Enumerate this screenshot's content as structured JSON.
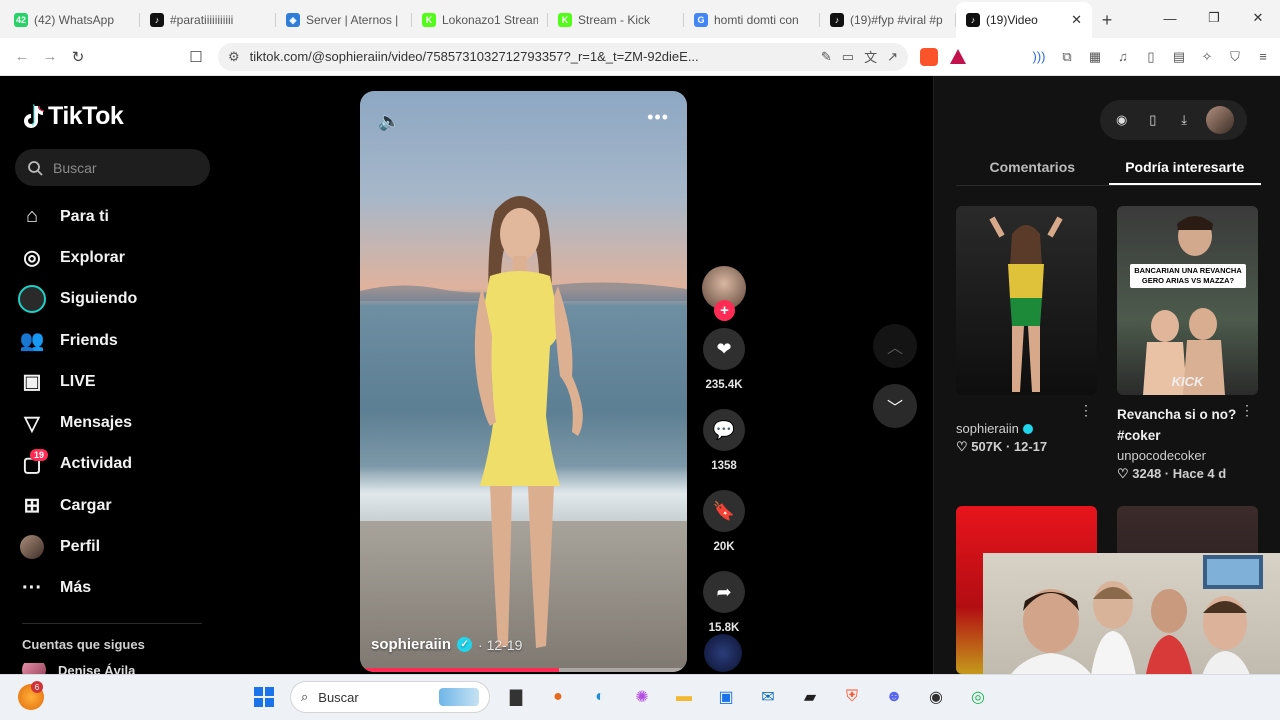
{
  "browser": {
    "tabs": [
      {
        "title": "(42) WhatsApp",
        "fav": "42",
        "color": "#25d366",
        "active": false
      },
      {
        "title": "#paratiiiiiiiiiii",
        "fav": "♪",
        "color": "#111111",
        "active": false
      },
      {
        "title": "Server | Aternos |",
        "fav": "◈",
        "color": "#2f7fd8",
        "active": false
      },
      {
        "title": "Lokonazo1 Stream",
        "fav": "K",
        "color": "#53fc18",
        "active": false
      },
      {
        "title": "Stream - Kick",
        "fav": "K",
        "color": "#53fc18",
        "active": false
      },
      {
        "title": "homti domti con",
        "fav": "G",
        "color": "#4285f4",
        "active": false
      },
      {
        "title": "(19)#fyp #viral #p",
        "fav": "♪",
        "color": "#111111",
        "active": false
      },
      {
        "title": "(19)Video",
        "fav": "♪",
        "color": "#111111",
        "active": true
      }
    ],
    "new_tab": "+",
    "url": "tiktok.com/@sophieraiin/video/7585731032712793357?_r=1&_t=ZM-92dieE..."
  },
  "sidebar": {
    "logo": "TikTok",
    "search_placeholder": "Buscar",
    "items": [
      {
        "label": "Para ti",
        "icon": "home-icon",
        "glyph": "⌂"
      },
      {
        "label": "Explorar",
        "icon": "compass-icon",
        "glyph": "◎"
      },
      {
        "label": "Siguiendo",
        "icon": "following-avatar-icon",
        "glyph": ""
      },
      {
        "label": "Friends",
        "icon": "friends-icon",
        "glyph": "👥"
      },
      {
        "label": "LIVE",
        "icon": "live-icon",
        "glyph": "▣"
      },
      {
        "label": "Mensajes",
        "icon": "send-icon",
        "glyph": "▽"
      },
      {
        "label": "Actividad",
        "icon": "activity-icon",
        "glyph": "▢",
        "badge": "19"
      },
      {
        "label": "Cargar",
        "icon": "upload-icon",
        "glyph": "⊞"
      },
      {
        "label": "Perfil",
        "icon": "profile-avatar-icon",
        "glyph": ""
      },
      {
        "label": "Más",
        "icon": "more-icon",
        "glyph": "···"
      }
    ],
    "following_title": "Cuentas que sigues",
    "following_first": "Denise Ávila"
  },
  "video": {
    "author": "sophieraiin",
    "date": "· 12-19",
    "progress": 0.61
  },
  "actions": {
    "likes": "235.4K",
    "comments": "1358",
    "saves": "20K",
    "shares": "15.8K"
  },
  "right_panel": {
    "tabs": [
      "Comentarios",
      "Podría interesarte"
    ],
    "active_tab": 1,
    "cards": [
      {
        "title": "",
        "author": "sophieraiin",
        "verified": true,
        "meta": "♡ 507K · 12-17"
      },
      {
        "title": "Revancha si o no? #coker",
        "author": "unpocodecoker",
        "verified": false,
        "meta": "♡ 3248 · Hace 4 d",
        "overlay": "BANCARIAN UNA REVANCHA GERO ARIAS VS MAZZA?",
        "badge": "KICK"
      }
    ]
  },
  "taskbar": {
    "search_placeholder": "Buscar",
    "weather_badge": "6"
  },
  "colors": {
    "accent": "#fe2c55",
    "verified": "#20d5ec"
  }
}
